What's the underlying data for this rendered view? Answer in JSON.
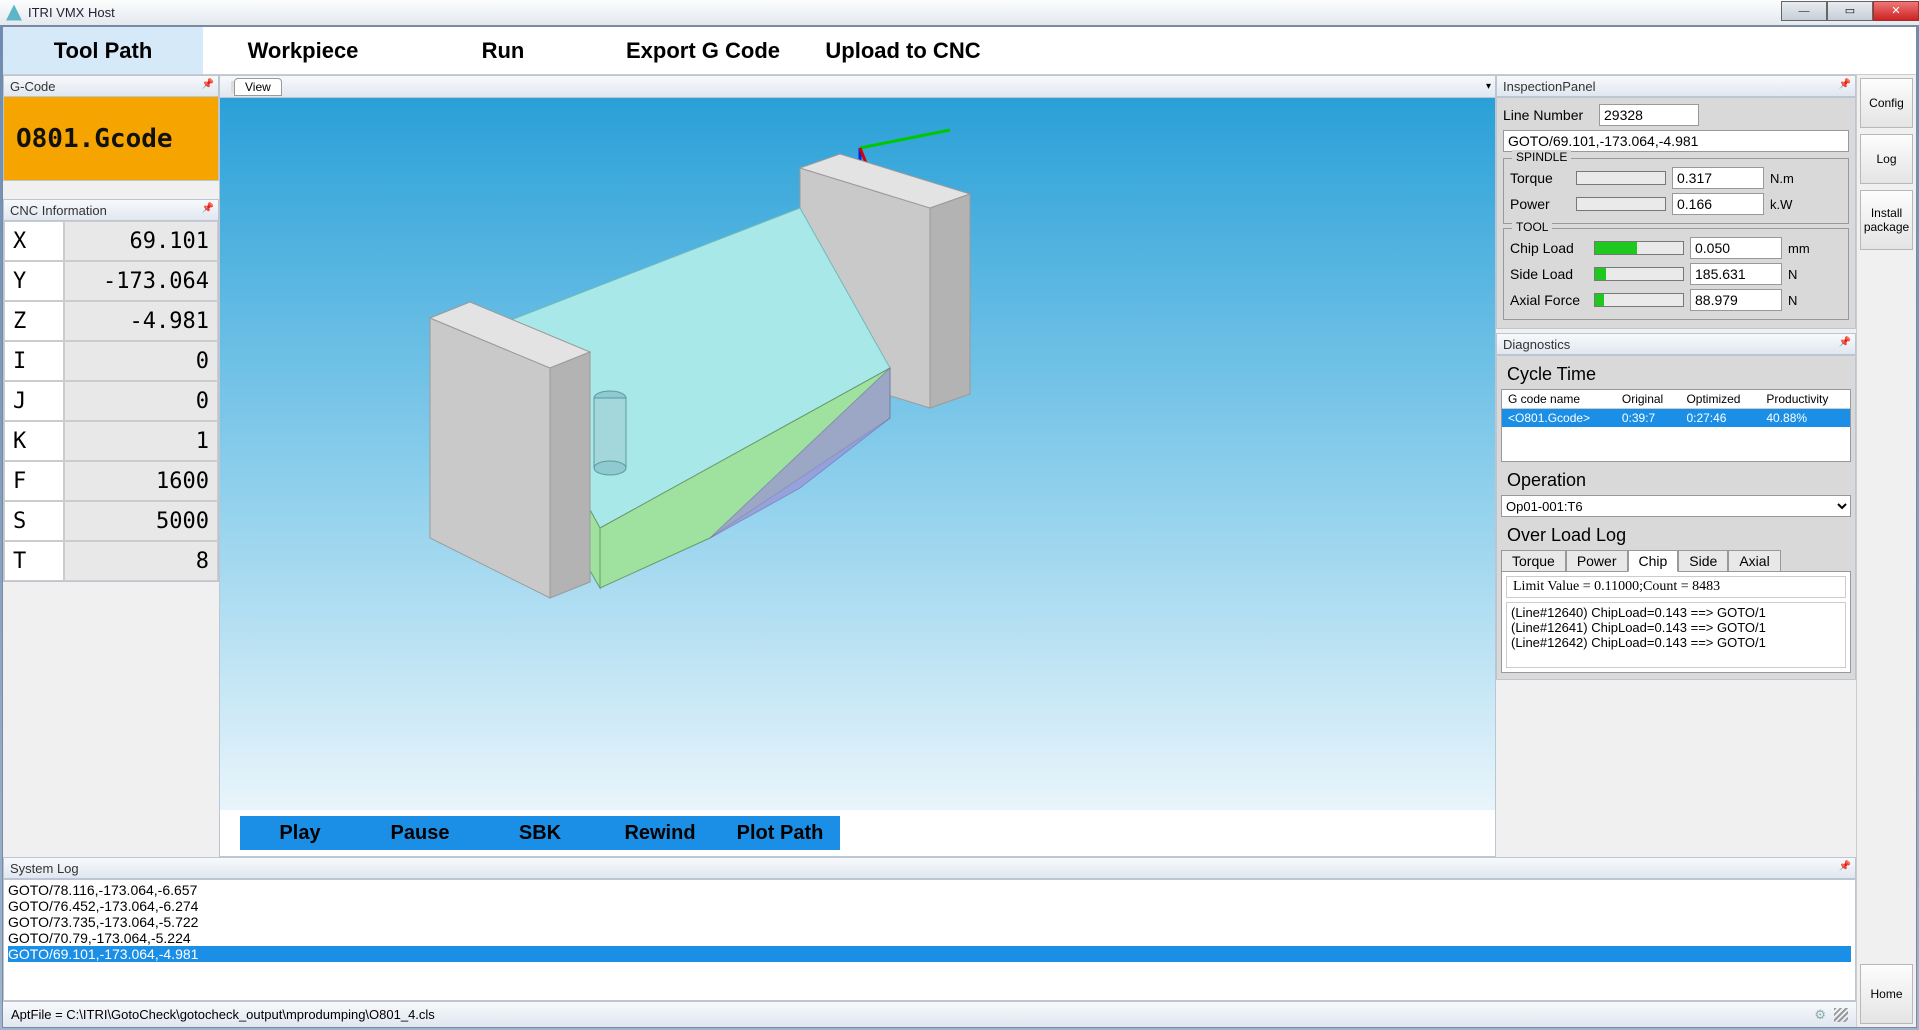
{
  "window": {
    "title": "ITRI VMX Host"
  },
  "tabs": {
    "items": [
      "Tool Path",
      "Workpiece",
      "Run",
      "Export G Code",
      "Upload to CNC"
    ],
    "active": 0
  },
  "side_buttons": {
    "config": "Config",
    "log": "Log",
    "install": "Install package",
    "home": "Home"
  },
  "gcode_panel": {
    "title": "G-Code",
    "filename": "O801.Gcode"
  },
  "cnc_panel": {
    "title": "CNC Information",
    "rows": [
      {
        "label": "X",
        "value": "69.101"
      },
      {
        "label": "Y",
        "value": "-173.064"
      },
      {
        "label": "Z",
        "value": "-4.981"
      },
      {
        "label": "I",
        "value": "0"
      },
      {
        "label": "J",
        "value": "0"
      },
      {
        "label": "K",
        "value": "1"
      },
      {
        "label": "F",
        "value": "1600"
      },
      {
        "label": "S",
        "value": "5000"
      },
      {
        "label": "T",
        "value": "8"
      }
    ]
  },
  "view": {
    "tab": "View"
  },
  "playbar": {
    "play": "Play",
    "pause": "Pause",
    "sbk": "SBK",
    "rewind": "Rewind",
    "plot": "Plot Path"
  },
  "inspection": {
    "title": "InspectionPanel",
    "line_number_label": "Line Number",
    "line_number": "29328",
    "goto": "GOTO/69.101,-173.064,-4.981",
    "spindle": {
      "title": "SPINDLE",
      "torque_label": "Torque",
      "torque": "0.317",
      "torque_unit": "N.m",
      "power_label": "Power",
      "power": "0.166",
      "power_unit": "k.W"
    },
    "tool": {
      "title": "TOOL",
      "chip_label": "Chip Load",
      "chip": "0.050",
      "chip_unit": "mm",
      "chip_pct": 48,
      "side_label": "Side Load",
      "side": "185.631",
      "side_unit": "N",
      "side_pct": 12,
      "axial_label": "Axial Force",
      "axial": "88.979",
      "axial_unit": "N",
      "axial_pct": 10
    }
  },
  "diagnostics": {
    "title": "Diagnostics",
    "cycle_title": "Cycle Time",
    "cycle_headers": [
      "G code name",
      "Original",
      "Optimized",
      "Productivity"
    ],
    "cycle_rows": [
      {
        "name": "<O801.Gcode>",
        "orig": "0:39:7",
        "opt": "0:27:46",
        "prod": "40.88%"
      }
    ],
    "operation_title": "Operation",
    "operation_value": "Op01-001:T6",
    "overload_title": "Over Load Log",
    "oll_tabs": [
      "Torque",
      "Power",
      "Chip",
      "Side",
      "Axial"
    ],
    "oll_active": 2,
    "oll_summary": "Limit Value = 0.11000;Count = 8483",
    "oll_lines": [
      "(Line#12640) ChipLoad=0.143 ==> GOTO/1",
      "(Line#12641) ChipLoad=0.143 ==> GOTO/1",
      "(Line#12642) ChipLoad=0.143 ==> GOTO/1"
    ]
  },
  "syslog": {
    "title": "System Log",
    "lines": [
      "GOTO/78.116,-173.064,-6.657",
      "GOTO/76.452,-173.064,-6.274",
      "GOTO/73.735,-173.064,-5.722",
      "GOTO/70.79,-173.064,-5.224",
      "GOTO/69.101,-173.064,-4.981"
    ],
    "selected": 4
  },
  "status": {
    "text": "AptFile = C:\\ITRI\\GotoCheck\\gotocheck_output\\mprodumping\\O801_4.cls"
  }
}
